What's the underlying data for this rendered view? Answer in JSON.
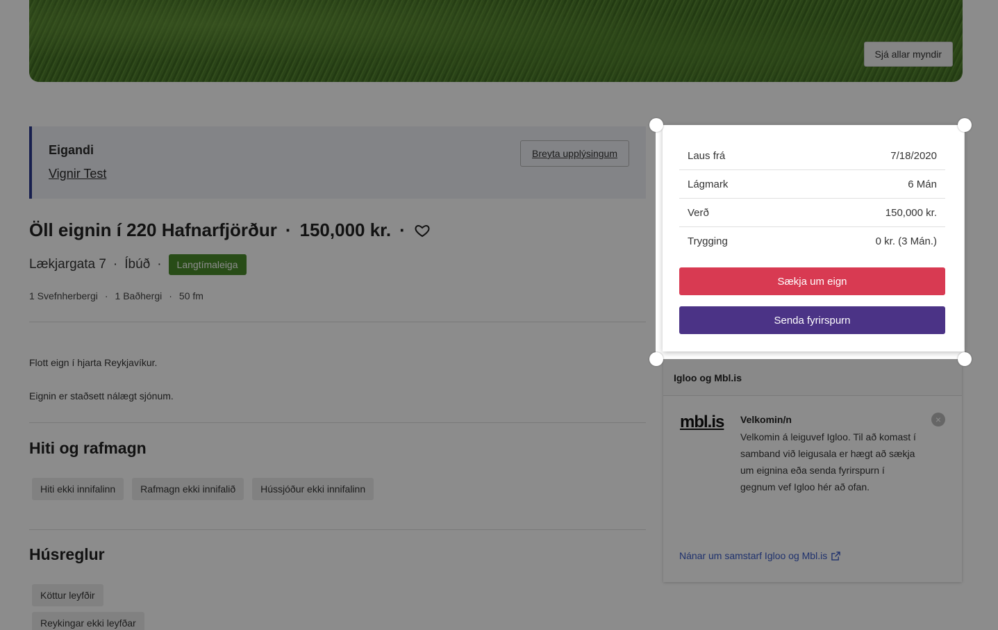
{
  "hero": {
    "see_all_photos": "Sjá allar myndir"
  },
  "owner": {
    "title": "Eigandi",
    "name": "Vignir Test",
    "edit_button": "Breyta upplýsingum"
  },
  "listing": {
    "title": "Öll eignin í 220 Hafnarfjörður",
    "price": "150,000 kr.",
    "address": "Lækjargata 7",
    "type": "Íbúð",
    "badge": "Langtímaleiga",
    "specs": [
      "1 Svefnherbergi",
      "1 Baðhergi",
      "50 fm"
    ],
    "description": [
      "Flott eign í hjarta Reykjavíkur.",
      "Eignin er staðsett nálægt sjónum."
    ]
  },
  "utilities": {
    "title": "Hiti og rafmagn",
    "chips": [
      "Hiti ekki innifalinn",
      "Rafmagn ekki innifalið",
      "Hússjóður ekki innifalinn"
    ]
  },
  "house_rules": {
    "title": "Húsreglur",
    "chips": [
      "Köttur leyfðir",
      "Reykingar ekki leyfðar"
    ]
  },
  "rent_card": {
    "rows": [
      {
        "label": "Laus frá",
        "value": "7/18/2020"
      },
      {
        "label": "Lágmark",
        "value": "6 Mán"
      },
      {
        "label": "Verð",
        "value": "150,000 kr."
      },
      {
        "label": "Trygging",
        "value": "0 kr. (3 Mán.)"
      }
    ],
    "apply_button": "Sækja um eign",
    "inquiry_button": "Senda fyrirspurn"
  },
  "info_card": {
    "title": "Igloo og Mbl.is",
    "logo_text": "mbl.is",
    "welcome_title": "Velkomin/n",
    "welcome_text": "Velkomin á leiguvef Igloo. Til að komast í samband við leigusala er hægt að sækja um eignina eða senda fyrirspurn í gegnum vef Igloo hér að ofan.",
    "link": "Nánar um samstarf Igloo og Mbl.is"
  },
  "colors": {
    "apply": "#d83a52",
    "inquiry": "#4b3386",
    "badge": "#4a8a2b",
    "owner_accent": "#2b3a8f"
  }
}
